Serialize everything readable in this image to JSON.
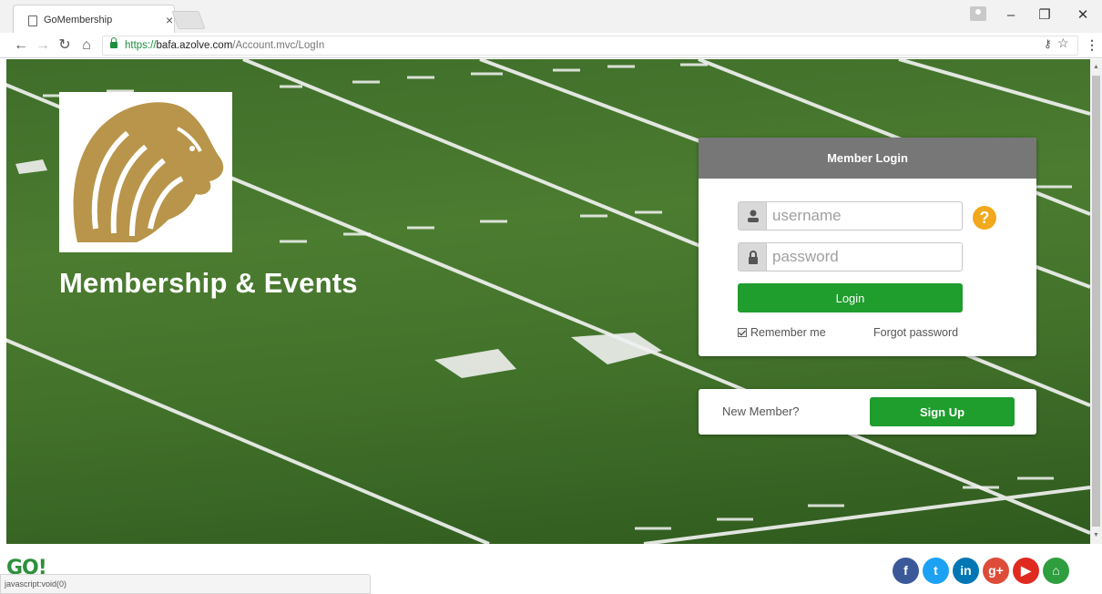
{
  "browser": {
    "tab_title": "GoMembership",
    "tab_close": "×",
    "url_secure": "https://",
    "url_host": "bafa.azolve.com",
    "url_path": "/Account.mvc/LogIn",
    "status_text": "javascript:void(0)"
  },
  "brand": {
    "title": "Membership & Events",
    "logo_color": "#b8954a"
  },
  "login": {
    "header": "Member Login",
    "username_placeholder": "username",
    "password_placeholder": "password",
    "help_label": "?",
    "login_button": "Login",
    "remember_label": "Remember me",
    "forgot_label": "Forgot password"
  },
  "signup": {
    "prompt": "New Member?",
    "button": "Sign Up"
  },
  "footer": {
    "go_logo": "GO!",
    "social": [
      {
        "name": "facebook",
        "glyph": "f",
        "color": "#3b5998"
      },
      {
        "name": "twitter",
        "glyph": "t",
        "color": "#1da1f2"
      },
      {
        "name": "linkedin",
        "glyph": "in",
        "color": "#0077b5"
      },
      {
        "name": "google-plus",
        "glyph": "g+",
        "color": "#dd4b39"
      },
      {
        "name": "youtube",
        "glyph": "▶",
        "color": "#e02a20"
      },
      {
        "name": "home",
        "glyph": "⌂",
        "color": "#2e9e3e"
      }
    ]
  },
  "colors": {
    "green": "#1f9d2d",
    "header_gray": "#777777",
    "help_orange": "#f2a81d"
  }
}
